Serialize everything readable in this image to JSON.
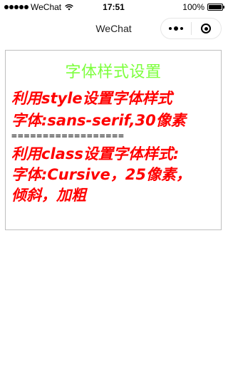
{
  "status_bar": {
    "carrier": "WeChat",
    "time": "17:51",
    "battery_percent": "100%",
    "battery_level": 1.0
  },
  "nav": {
    "title": "WeChat"
  },
  "content": {
    "heading": "字体样式设置",
    "style_lines": [
      "利用style设置字体样式",
      "字体:sans-serif,30像素"
    ],
    "separator": "==================",
    "class_lines": [
      "利用class设置字体样式:",
      "字体:Cursive，25像素，",
      "倾斜，加粗"
    ]
  },
  "colors": {
    "heading": "#7dff3d",
    "emphasis_text": "#ff0000"
  }
}
